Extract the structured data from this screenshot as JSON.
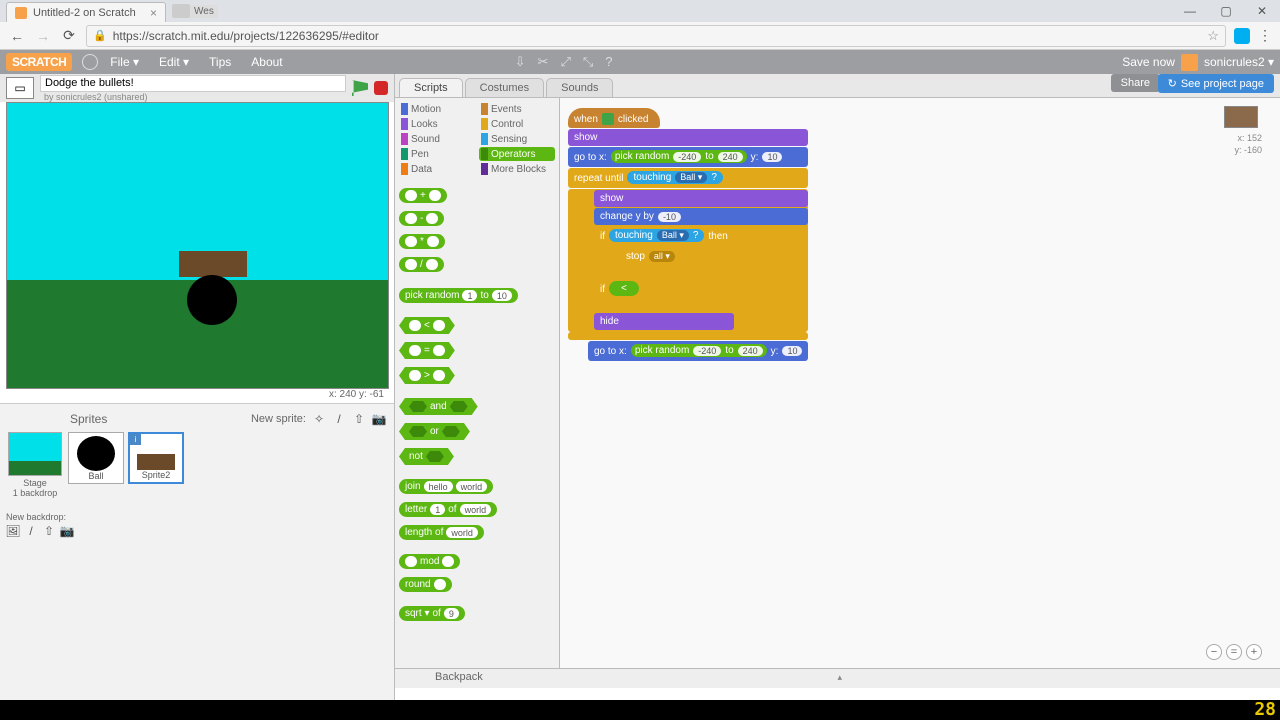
{
  "browser": {
    "tab_title": "Untitled-2 on Scratch",
    "url": "https://scratch.mit.edu/projects/122636295/#editor",
    "user_badge": "Wes"
  },
  "menubar": {
    "logo": "SCRATCH",
    "file": "File ▾",
    "edit": "Edit ▾",
    "tips": "Tips",
    "about": "About",
    "save": "Save now",
    "user": "sonicrules2 ▾"
  },
  "project": {
    "title": "Dodge the bullets!",
    "byline": "by sonicrules2 (unshared)"
  },
  "stage_coords": "x: 240  y: -61",
  "sprites": {
    "label": "Sprites",
    "new_label": "New sprite:",
    "stage": "Stage",
    "stage_sub": "1 backdrop",
    "new_backdrop": "New backdrop:",
    "list": [
      {
        "name": "Ball"
      },
      {
        "name": "Sprite2"
      }
    ]
  },
  "tabs": {
    "scripts": "Scripts",
    "costumes": "Costumes",
    "sounds": "Sounds"
  },
  "share": "Share",
  "see_project": "See project page",
  "categories": [
    {
      "name": "Motion",
      "color": "#4a6cd4"
    },
    {
      "name": "Events",
      "color": "#c88330"
    },
    {
      "name": "Looks",
      "color": "#8a55d7"
    },
    {
      "name": "Control",
      "color": "#e1a91a"
    },
    {
      "name": "Sound",
      "color": "#bb42c3"
    },
    {
      "name": "Sensing",
      "color": "#2ca5e2"
    },
    {
      "name": "Pen",
      "color": "#0e9a6c"
    },
    {
      "name": "Operators",
      "color": "#5cb712"
    },
    {
      "name": "Data",
      "color": "#ee7d16"
    },
    {
      "name": "More Blocks",
      "color": "#632d99"
    }
  ],
  "palette_ops": {
    "pick_random": "pick random",
    "to": "to",
    "and": "and",
    "or": "or",
    "not": "not",
    "join": "join",
    "hello": "hello",
    "world": "world",
    "letter": "letter",
    "of": "of",
    "length_of": "length of",
    "mod": "mod",
    "round": "round",
    "sqrt": "sqrt ▾"
  },
  "script": {
    "when_clicked": "when        clicked",
    "show": "show",
    "go_to_x": "go to x:",
    "pick_random": "pick random",
    "to": "to",
    "y": "y:",
    "repeat_until": "repeat until",
    "touching": "touching",
    "ball": "Ball ▾",
    "change_y_by": "change y by",
    "neg10": "-10",
    "if": "if",
    "then": "then",
    "stop": "stop",
    "all": "all ▾",
    "hide": "hide",
    "v_neg240": "-240",
    "v_240": "240",
    "v_10": "10"
  },
  "canvas_coords": {
    "x": "x: 152",
    "y": "y: -160"
  },
  "backpack": "Backpack",
  "timecode": "28"
}
